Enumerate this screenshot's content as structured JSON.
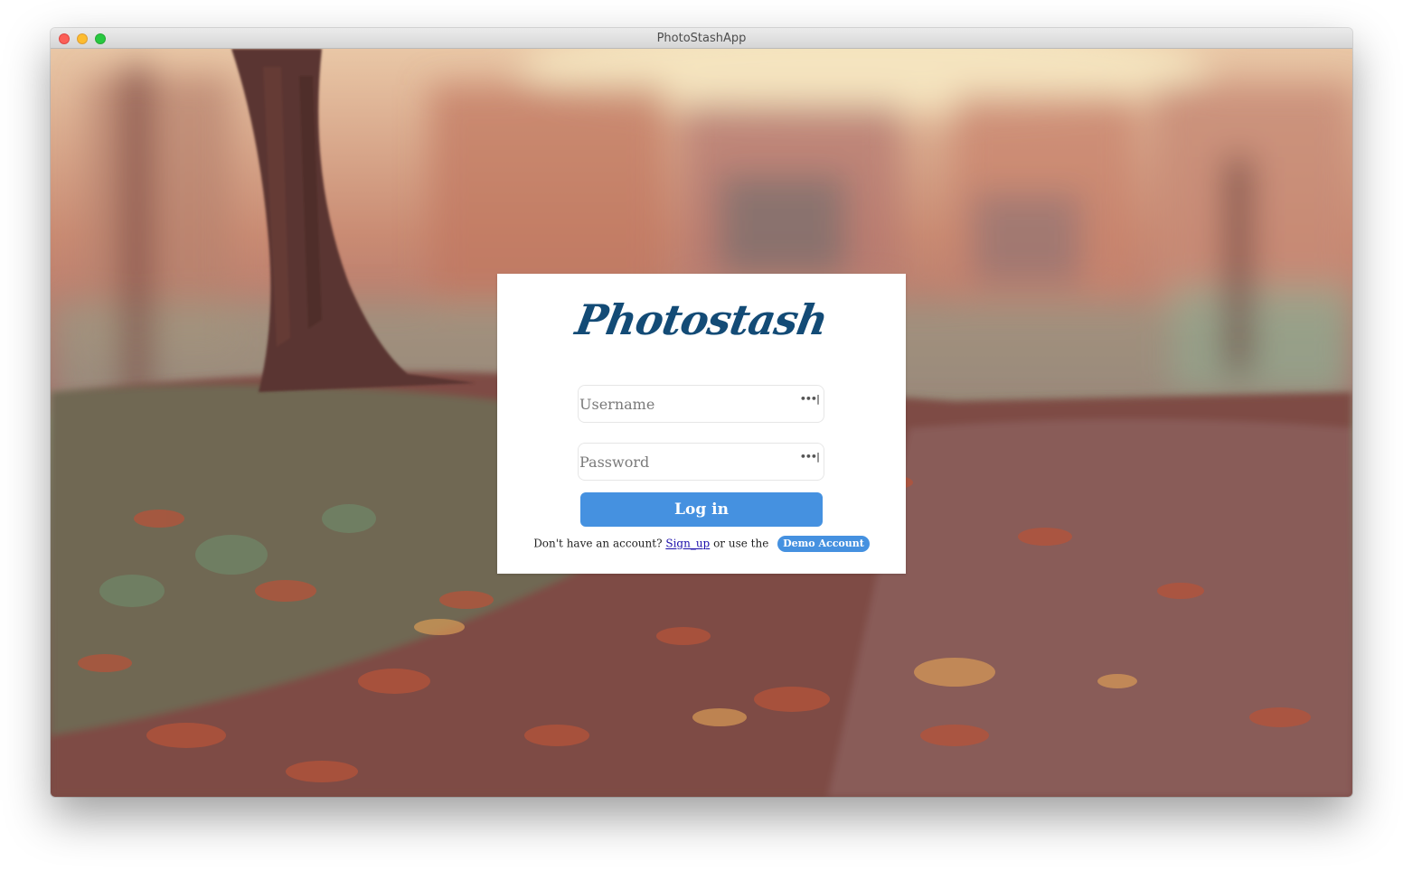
{
  "window": {
    "title": "PhotoStashApp"
  },
  "login": {
    "brand": "Photostash",
    "username_placeholder": "Username",
    "password_placeholder": "Password",
    "login_label": "Log in",
    "no_account_text": "Don't have an account?",
    "signup_link": "Sign_up",
    "or_use_text": "or use the",
    "demo_label": "Demo Account",
    "field_icon": "key-icon"
  },
  "colors": {
    "brand": "#134b76",
    "accent": "#4591e0",
    "link": "#1a0dab",
    "card": "#ffffff"
  }
}
